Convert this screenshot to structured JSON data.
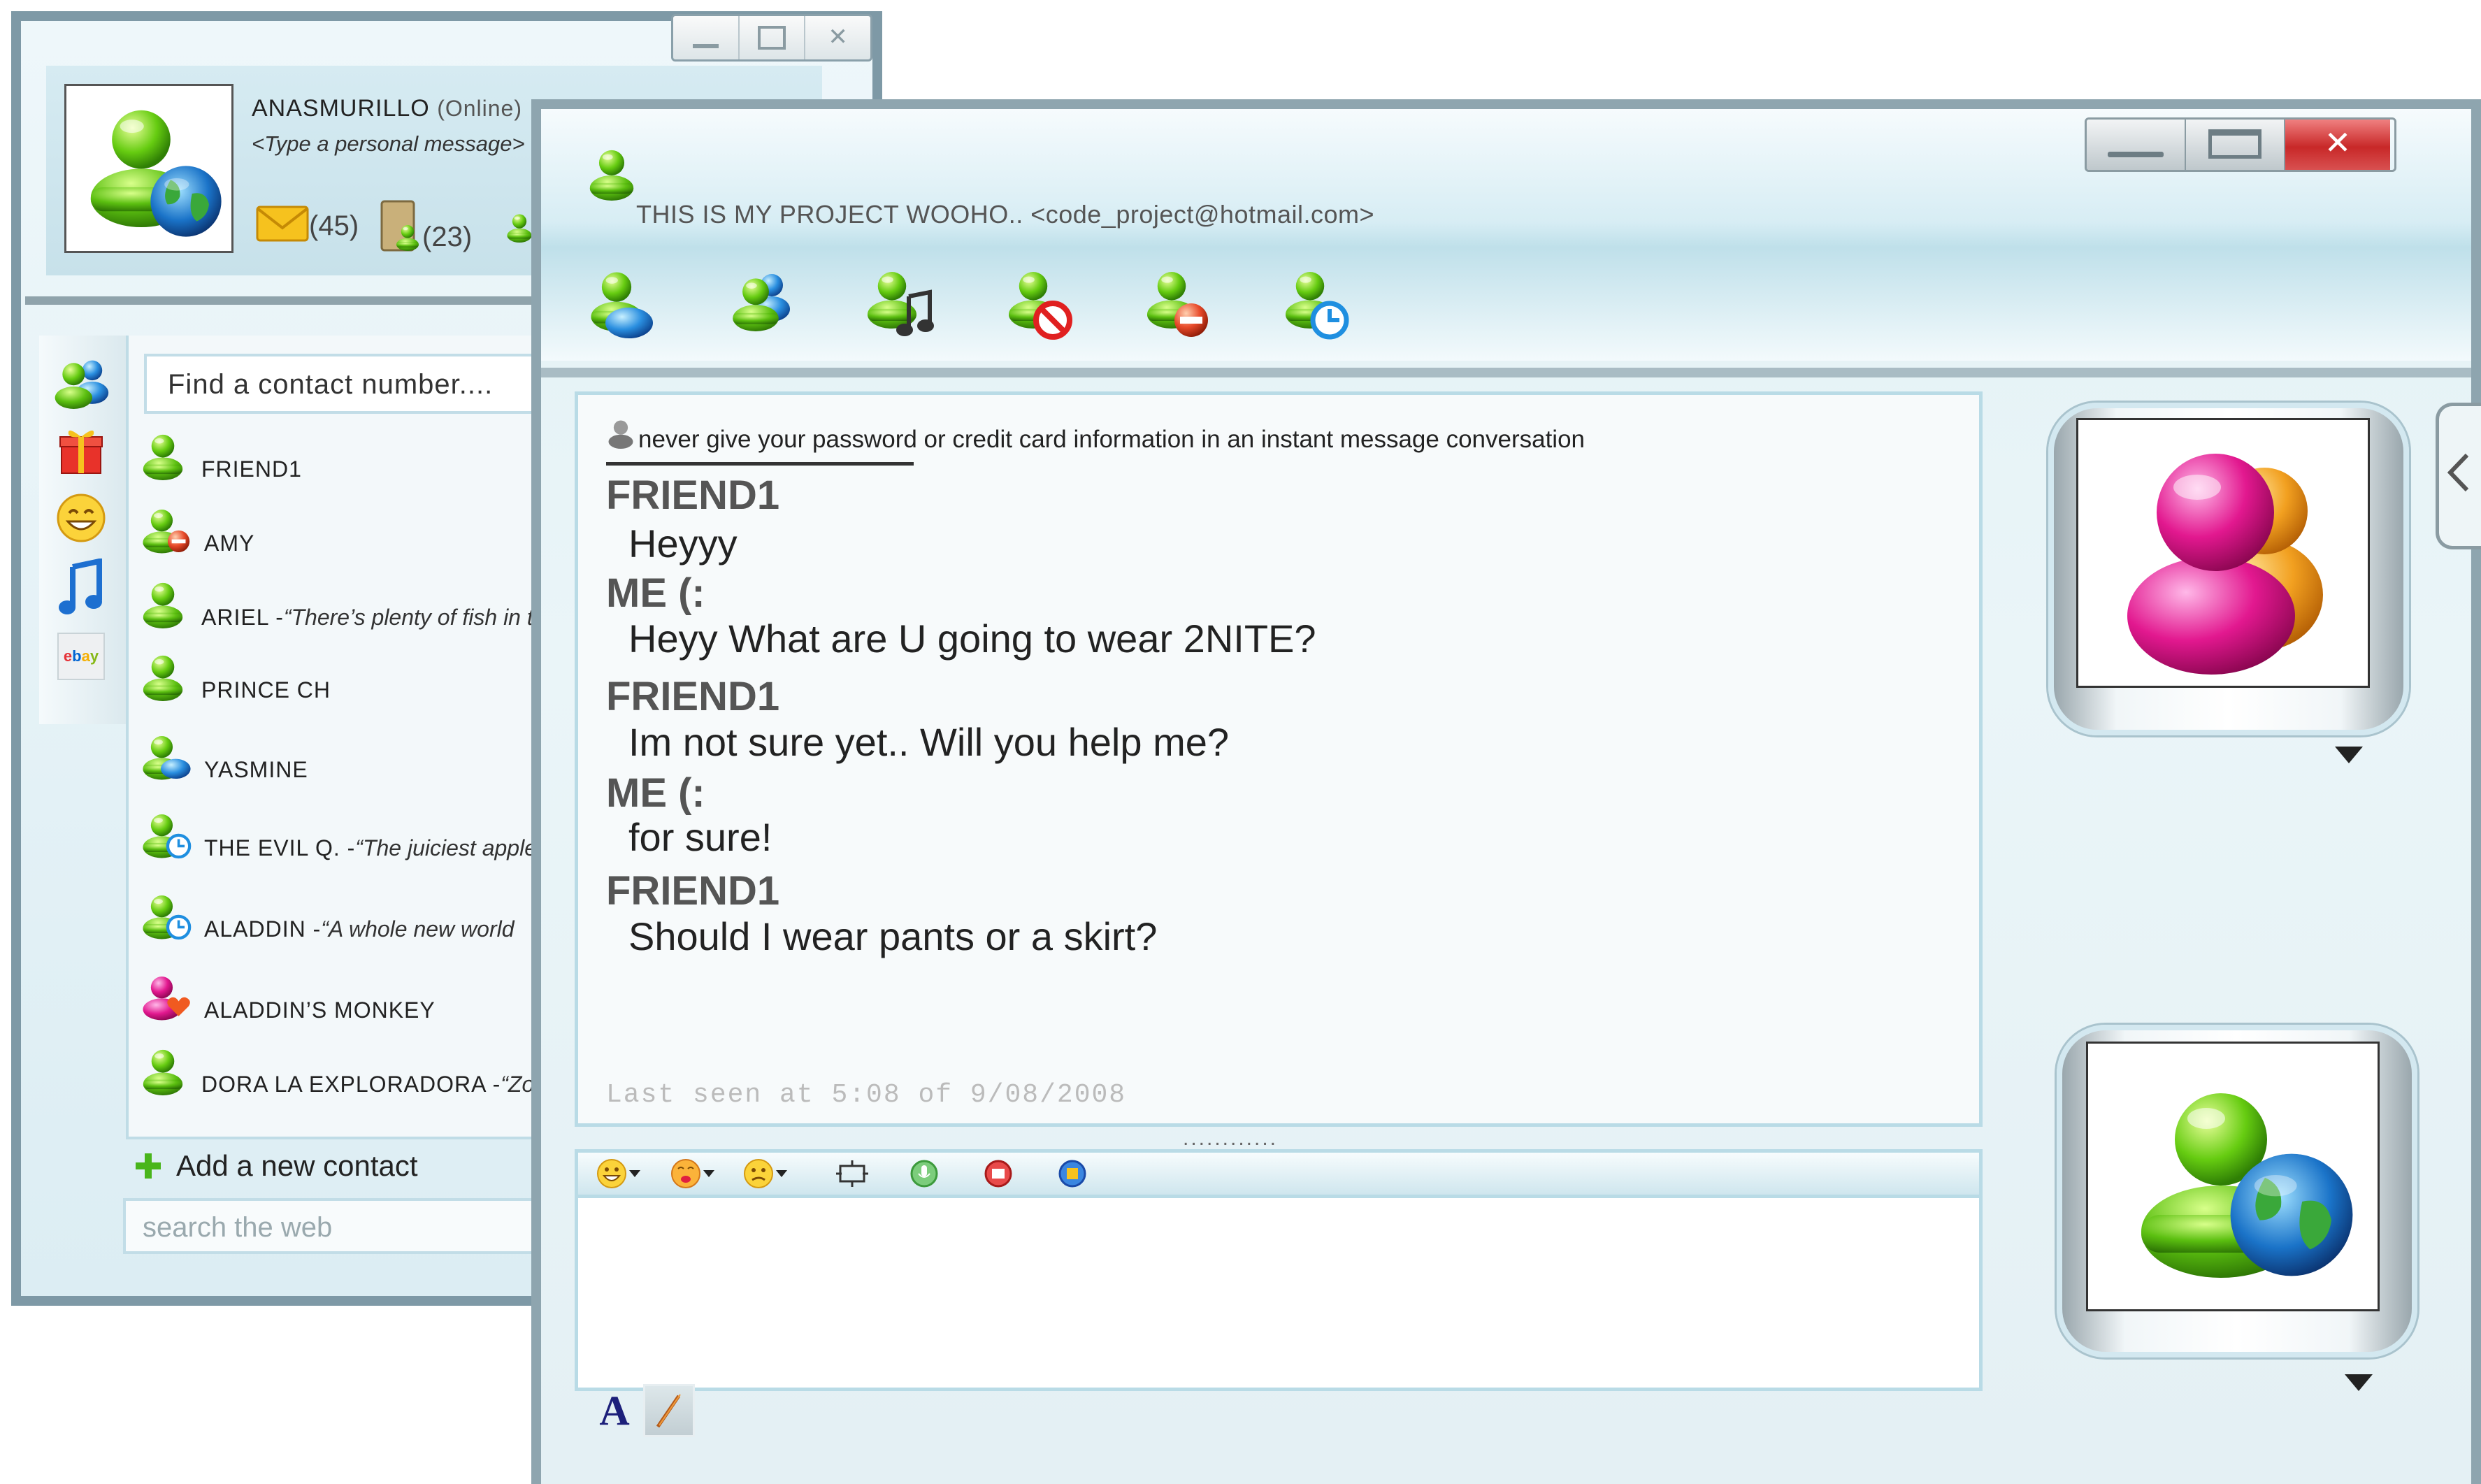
{
  "contact_window": {
    "user_name": "ANASMURILLO",
    "status": "(Online)",
    "personal_message": "<Type a personal message>",
    "mail_count": "(45)",
    "contacts_count": "(23)",
    "find_placeholder": "Find a contact number....",
    "side_tabs": [
      "contacts-icon",
      "gift-icon",
      "emoticon-icon",
      "music-icon",
      "ebay-icon"
    ],
    "ebay_label": "ebay",
    "contacts": [
      {
        "name": "FRIEND1",
        "message": "",
        "status": "online"
      },
      {
        "name": "AMY",
        "message": "",
        "status": "busy"
      },
      {
        "name": "ARIEL - ",
        "message": "“There’s plenty of fish in t",
        "status": "online"
      },
      {
        "name": "PRINCE CH",
        "message": "",
        "status": "online"
      },
      {
        "name": "YASMINE",
        "message": "",
        "status": "blue"
      },
      {
        "name": "THE EVIL Q. - ",
        "message": "“The juiciest apple",
        "status": "away"
      },
      {
        "name": "ALADDIN - ",
        "message": "“A whole new world",
        "status": "away"
      },
      {
        "name": "ALADDIN’S MONKEY",
        "message": "",
        "status": "love"
      },
      {
        "name": "DORA LA EXPLORADORA - ",
        "message": "“Zo",
        "status": "online"
      }
    ],
    "add_contact_label": "Add a new contact",
    "search_web_placeholder": "search the web"
  },
  "chat_window": {
    "title": "THIS IS MY PROJECT WOOHO.. <code_project@hotmail.com>",
    "toolbar_icons": [
      "invite-contact-icon",
      "share-icon",
      "music-icon",
      "block-icon",
      "busy-icon",
      "away-icon"
    ],
    "warning": "never give your password or credit card information in an instant message conversation",
    "messages": [
      {
        "sender": "FRIEND1",
        "text": "Heyyy"
      },
      {
        "sender": "ME (:",
        "text": "Heyy What are U going to wear 2NITE?"
      },
      {
        "sender": "FRIEND1",
        "text": "Im not sure yet.. Will you help me?"
      },
      {
        "sender": "ME (:",
        "text": "for sure!"
      },
      {
        "sender": "FRIEND1",
        "text": "Should I wear pants  or a skirt?"
      }
    ],
    "last_seen": "Last seen at 5:08 of 9/08/2008",
    "grip": "............",
    "input_toolbar": [
      "smile-emoticon-icon",
      "kiss-emoticon-icon",
      "confused-emoticon-icon",
      "nudge-icon",
      "voice-clip-icon",
      "video-icon",
      "activity-icon"
    ],
    "font_button_label": "A"
  },
  "colors": {
    "online": "#4cc21a",
    "busy": "#e84a2a",
    "away_blue": "#1f8fe0",
    "love": "#e0206f",
    "accent": "#b9dbe6"
  }
}
